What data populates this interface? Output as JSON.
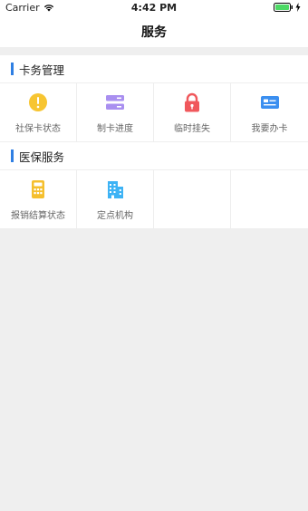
{
  "status_bar": {
    "carrier": "Carrier",
    "time": "4:42 PM"
  },
  "nav": {
    "title": "服务"
  },
  "sections": [
    {
      "title": "卡务管理",
      "items": [
        {
          "label": "社保卡状态",
          "icon": "alert-icon"
        },
        {
          "label": "制卡进度",
          "icon": "progress-icon"
        },
        {
          "label": "临时挂失",
          "icon": "lock-icon"
        },
        {
          "label": "我要办卡",
          "icon": "card-icon"
        }
      ]
    },
    {
      "title": "医保服务",
      "items": [
        {
          "label": "报销结算状态",
          "icon": "calculator-icon"
        },
        {
          "label": "定点机构",
          "icon": "building-icon"
        }
      ]
    }
  ],
  "colors": {
    "accent": "#2f7fe3",
    "alert_yellow": "#f7c531",
    "progress_purple": "#a98ff0",
    "lock_red": "#f0585c",
    "card_blue": "#3b8ff0",
    "calc_yellow": "#f5bf2d",
    "building_blue": "#3eb3f5",
    "battery_green": "#4cd964"
  }
}
